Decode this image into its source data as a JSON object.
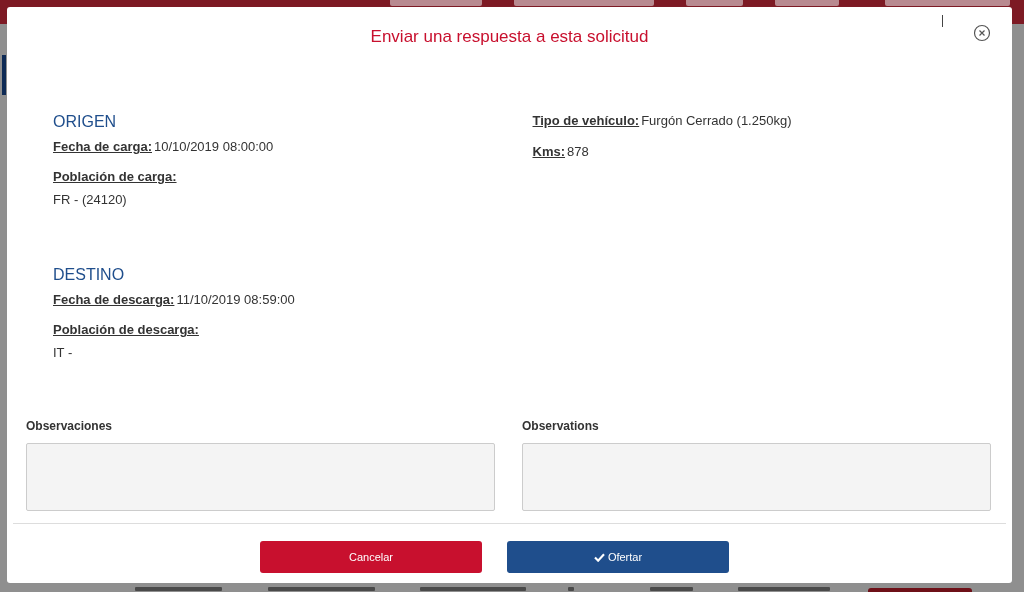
{
  "dialog": {
    "title": "Enviar una respuesta a esta solicitud",
    "sections": [
      {
        "heading": "ORIGEN",
        "fields": [
          {
            "label": "Fecha de carga:",
            "value": "10/10/2019 08:00:00",
            "kind": "inline"
          },
          {
            "label": "Población de carga:",
            "value": "FR - (24120)",
            "kind": "block"
          }
        ]
      },
      {
        "heading": "DESTINO",
        "fields": [
          {
            "label": "Fecha de descarga:",
            "value": "11/10/2019 08:59:00",
            "kind": "inline"
          },
          {
            "label": "Población de descarga:",
            "value": "IT -",
            "kind": "block"
          }
        ]
      }
    ],
    "details": [
      {
        "label": "Tipo de vehículo:",
        "value": "Furgón Cerrado (1.250kg)"
      },
      {
        "label": "Kms:",
        "value": "878"
      }
    ],
    "notes": [
      {
        "label": "Observaciones"
      },
      {
        "label": "Observations"
      }
    ],
    "buttons": [
      {
        "label": "Cancelar",
        "kind": "cancel"
      },
      {
        "label": "Ofertar",
        "kind": "confirm"
      }
    ]
  }
}
